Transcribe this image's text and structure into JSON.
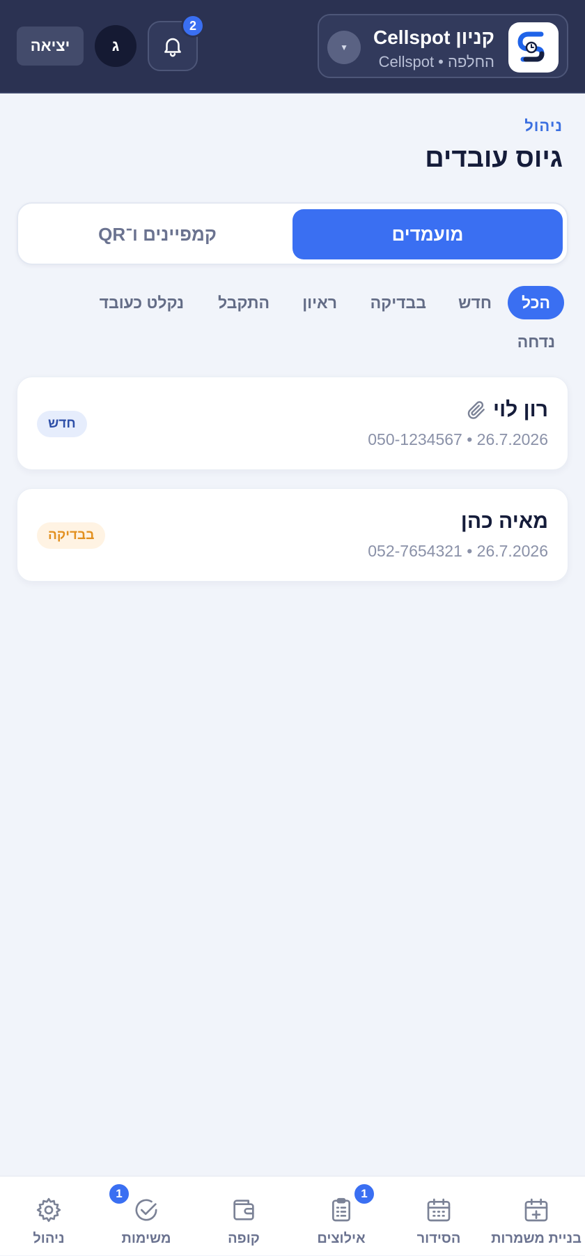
{
  "header": {
    "store_name": "קניון Cellspot",
    "store_subtitle": "החלפה • Cellspot",
    "notifications_count": "2",
    "avatar_initial": "ג",
    "logout_label": "יציאה"
  },
  "breadcrumb": "ניהול",
  "page_title": "גיוס עובדים",
  "segment_tabs": [
    {
      "label": "מועמדים",
      "active": true
    },
    {
      "label": "קמפיינים ו־QR",
      "active": false
    }
  ],
  "filters": [
    {
      "label": "הכל",
      "active": true
    },
    {
      "label": "חדש",
      "active": false
    },
    {
      "label": "בבדיקה",
      "active": false
    },
    {
      "label": "ראיון",
      "active": false
    },
    {
      "label": "התקבל",
      "active": false
    },
    {
      "label": "נקלט כעובד",
      "active": false
    },
    {
      "label": "נדחה",
      "active": false
    }
  ],
  "candidates": [
    {
      "name": "רון לוי",
      "has_attachment": true,
      "date": "26.7.2026",
      "phone": "050-1234567",
      "status": "חדש"
    },
    {
      "name": "מאיה כהן",
      "has_attachment": false,
      "date": "26.7.2026",
      "phone": "052-7654321",
      "status": "בבדיקה"
    }
  ],
  "bottom_nav": [
    {
      "label": "בניית משמרות",
      "icon": "calendar-plus-icon"
    },
    {
      "label": "הסידור",
      "icon": "calendar-icon"
    },
    {
      "label": "אילוצים",
      "icon": "clipboard-list-icon",
      "badge": "1"
    },
    {
      "label": "קופה",
      "icon": "wallet-icon"
    },
    {
      "label": "משימות",
      "icon": "check-circle-icon",
      "badge": "1"
    },
    {
      "label": "ניהול",
      "icon": "gear-icon"
    }
  ],
  "colors": {
    "header_bg": "#2b3252",
    "accent": "#3a6ff2",
    "page_bg": "#f1f4fa"
  }
}
